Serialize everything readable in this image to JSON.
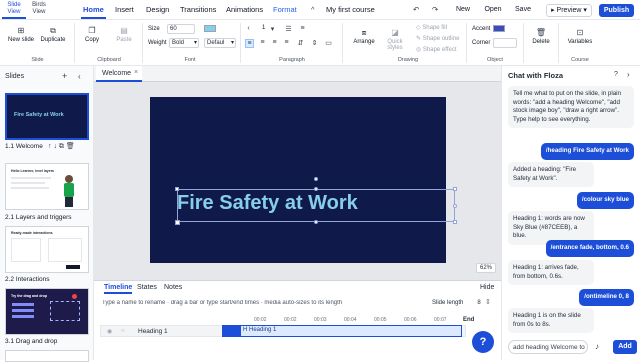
{
  "topbar": {
    "view_tabs": [
      "Slide View",
      "Birds View"
    ],
    "tabs": [
      "Home",
      "Insert",
      "Design",
      "Transitions",
      "Animations",
      "Format"
    ],
    "collapse_glyph": "^",
    "doc_title": "My first course",
    "new_label": "New",
    "open_label": "Open",
    "save_label": "Save",
    "preview_label": "Preview",
    "publish_label": "Publish"
  },
  "ribbon": {
    "slide": {
      "new_slide": "New slide",
      "duplicate": "Duplicate",
      "group": "Slide"
    },
    "clipboard": {
      "copy": "Copy",
      "paste": "Paste",
      "group": "Clipboard"
    },
    "font": {
      "size_label": "Size",
      "size_value": "60",
      "weight_label": "Weight",
      "weight_value": "Bold",
      "family_value": "Defaul",
      "group": "Font",
      "color": "#87CEEB"
    },
    "paragraph": {
      "spacing_value": "1",
      "group": "Paragraph"
    },
    "drawing": {
      "arrange": "Arrange",
      "quick_styles": "Quick styles",
      "shape_fill": "Shape fill",
      "shape_outline": "Shape outline",
      "shape_effect": "Shape effect",
      "group": "Drawing"
    },
    "object": {
      "accent_label": "Accent",
      "accent_color": "#3b4cc0",
      "corner_label": "Corner",
      "group": "Object"
    },
    "delete": "Delete",
    "course": {
      "variables": "Variables",
      "group": "Course"
    }
  },
  "left_panel": {
    "title": "Slides",
    "slides": [
      {
        "label": "1.1 Welcome",
        "heading": "Fire Safety at Work"
      },
      {
        "label": "2.1 Layers and triggers",
        "heading": "Hello Learner, level layers"
      },
      {
        "label": "2.2 Interactions",
        "heading": "Ready-made interactions"
      },
      {
        "label": "3.1 Drag and drop",
        "heading": "Try the drag and drop"
      }
    ]
  },
  "editor": {
    "tab_label": "Welcome",
    "zoom": "62%",
    "slide_heading": "Fire Safety at Work",
    "heading_color": "#87CEEB",
    "slide_bg": "#0f1a4a"
  },
  "timeline": {
    "tabs": [
      "Timeline",
      "States",
      "Notes"
    ],
    "hide_label": "Hide",
    "hint": "Type a name to rename · drag a bar or type start/end times · media auto-sizes to its length",
    "slide_length_label": "Slide length",
    "slide_length_value": "8",
    "end_label": "End",
    "ticks": [
      "00:02",
      "00:02",
      "00:03",
      "00:04",
      "00:05",
      "00:06",
      "00:07"
    ],
    "row_name": "Heading 1",
    "bar_label": "Heading 1",
    "bar_start": 0,
    "bar_end": 8
  },
  "chat": {
    "title": "Chat with Floza",
    "messages": [
      {
        "role": "bot",
        "text": "Tell me what to put on the slide, in plain words: \"add a heading Welcome\", \"add stock image boy\", \"draw a right arrow\". Type help to see everything."
      },
      {
        "role": "user",
        "text": "/heading Fire Safety at Work"
      },
      {
        "role": "bot",
        "text": "Added a heading: \"Fire Safety at Work\"."
      },
      {
        "role": "user",
        "text": "/colour sky blue"
      },
      {
        "role": "bot",
        "text": "Heading 1: words are now Sky Blue (#87CEEB), a blue."
      },
      {
        "role": "user",
        "text": "/entrance fade, bottom, 0.6"
      },
      {
        "role": "bot",
        "text": "Heading 1: arrives fade, from bottom, 0.6s."
      },
      {
        "role": "user",
        "text": "/ontimeline 0, 8"
      },
      {
        "role": "bot",
        "text": "Heading 1 is on the slide from 0s to 8s."
      }
    ],
    "input_value": "add heading Welcome to",
    "add_label": "Add",
    "help_glyph": "?"
  }
}
